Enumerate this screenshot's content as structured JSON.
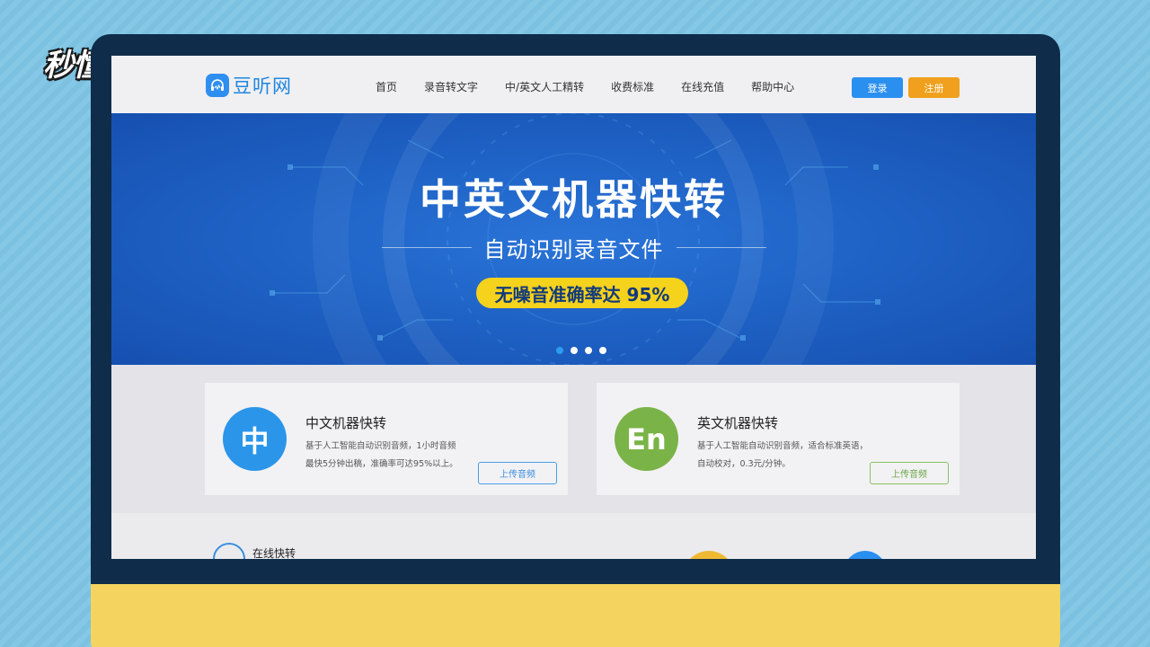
{
  "overlay_logo": "秒懂视频",
  "site": {
    "brand": "豆听网",
    "nav": [
      "首页",
      "录音转文字",
      "中/英文人工精转",
      "收费标准",
      "在线充值",
      "帮助中心"
    ],
    "login_label": "登录",
    "register_label": "注册"
  },
  "banner": {
    "title": "中英文机器快转",
    "subtitle": "自动识别录音文件",
    "pill": "无噪音准确率达 95%",
    "slides": 4,
    "active_slide": 1
  },
  "cards": [
    {
      "icon_text": "中",
      "title": "中文机器快转",
      "desc_line1": "基于人工智能自动识别音频，1小时音频",
      "desc_line2": "最快5分钟出稿，准确率可达95%以上。",
      "button": "上传音频",
      "accent": "#2b95ea"
    },
    {
      "icon_text": "En",
      "title": "英文机器快转",
      "desc_line1": "基于人工智能自动识别音频，适合标准英语，",
      "desc_line2": "自动校对，0.3元/分钟。",
      "button": "上传音频",
      "accent": "#7ab347"
    }
  ],
  "lower": {
    "title": "在线快转"
  },
  "colors": {
    "primary": "#2b8ff0",
    "register": "#f0a01c",
    "banner": "#1f63c6",
    "pill": "#f5d21c",
    "monitor": "#0f2d4a",
    "stand": "#f4d35e"
  }
}
